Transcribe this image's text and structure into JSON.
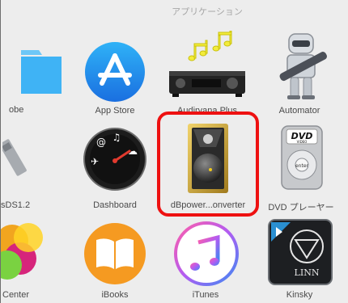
{
  "window": {
    "title": "アプリケーション"
  },
  "apps": [
    {
      "id": "adobe",
      "label": "obe"
    },
    {
      "id": "app-store",
      "label": "App Store"
    },
    {
      "id": "audirvana-plus",
      "label": "Audirvana Plus"
    },
    {
      "id": "automator",
      "label": "Automator"
    },
    {
      "id": "sds",
      "label": "sDS1.2"
    },
    {
      "id": "dashboard",
      "label": "Dashboard"
    },
    {
      "id": "dbpoweramp",
      "label": "dBpower...onverter"
    },
    {
      "id": "dvd-player",
      "label": "DVD プレーヤー"
    },
    {
      "id": "game-center",
      "label": "Center"
    },
    {
      "id": "ibooks",
      "label": "iBooks"
    },
    {
      "id": "itunes",
      "label": "iTunes"
    },
    {
      "id": "kinsky",
      "label": "Kinsky"
    }
  ],
  "icon_text": {
    "dvd": "DVD",
    "dvd_sub": "VIDEO",
    "enter": "enter",
    "linn": "LINN"
  },
  "highlight_color": "#ee1111"
}
